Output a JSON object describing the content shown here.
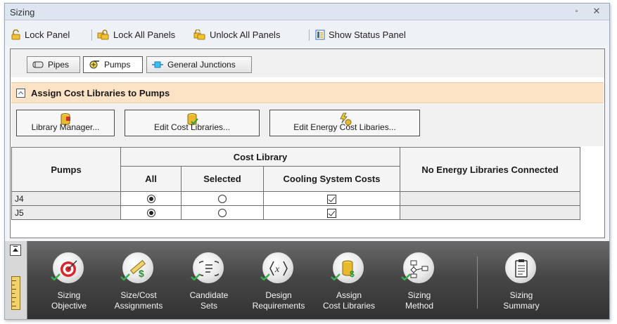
{
  "window": {
    "title": "Sizing"
  },
  "toolbar": {
    "lock_panel": "Lock Panel",
    "lock_all": "Lock All Panels",
    "unlock_all": "Unlock All Panels",
    "show_status": "Show Status Panel"
  },
  "tabs": [
    {
      "label": "Pipes",
      "icon": "pipe-icon",
      "active": false
    },
    {
      "label": "Pumps",
      "icon": "pump-icon",
      "active": true
    },
    {
      "label": "General Junctions",
      "icon": "junction-icon",
      "active": false
    }
  ],
  "section": {
    "title": "Assign Cost Libraries to Pumps"
  },
  "library_buttons": {
    "manager": "Library Manager...",
    "edit_cost": "Edit Cost Libraries...",
    "edit_energy": "Edit Energy Cost Libaries..."
  },
  "table": {
    "pumps_header": "Pumps",
    "cost_library_header": "Cost Library",
    "col_all": "All",
    "col_selected": "Selected",
    "col_cooling": "Cooling System Costs",
    "energy_header": "No Energy Libraries Connected",
    "rows": [
      {
        "name": "J4",
        "all": true,
        "selected": false,
        "cooling": true
      },
      {
        "name": "J5",
        "all": true,
        "selected": false,
        "cooling": true
      }
    ]
  },
  "steps": [
    {
      "line1": "Sizing",
      "line2": "Objective",
      "icon": "target-icon",
      "done": true
    },
    {
      "line1": "Size/Cost",
      "line2": "Assignments",
      "icon": "ruler-dollar-icon",
      "done": true
    },
    {
      "line1": "Candidate",
      "line2": "Sets",
      "icon": "list-icon",
      "done": true
    },
    {
      "line1": "Design",
      "line2": "Requirements",
      "icon": "variable-icon",
      "done": true
    },
    {
      "line1": "Assign",
      "line2": "Cost Libraries",
      "icon": "database-dollar-icon",
      "done": true,
      "current": true
    },
    {
      "line1": "Sizing",
      "line2": "Method",
      "icon": "flowchart-icon",
      "done": true
    },
    {
      "line1": "Sizing",
      "line2": "Summary",
      "icon": "clipboard-icon",
      "done": false
    }
  ]
}
